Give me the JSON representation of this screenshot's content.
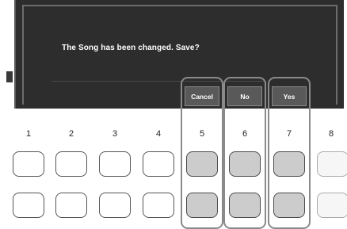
{
  "dialog": {
    "message": "The Song has been changed. Save?",
    "buttons": [
      "Cancel",
      "No",
      "Yes"
    ]
  },
  "panel": {
    "button_numbers": [
      "1",
      "2",
      "3",
      "4",
      "5",
      "6",
      "7",
      "8"
    ],
    "highlighted_buttons": [
      "5",
      "6",
      "7"
    ]
  },
  "colors": {
    "screen_bg": "#2d2d2d",
    "button_active": "#cccccc",
    "highlight_outline": "#8a8a8a"
  }
}
